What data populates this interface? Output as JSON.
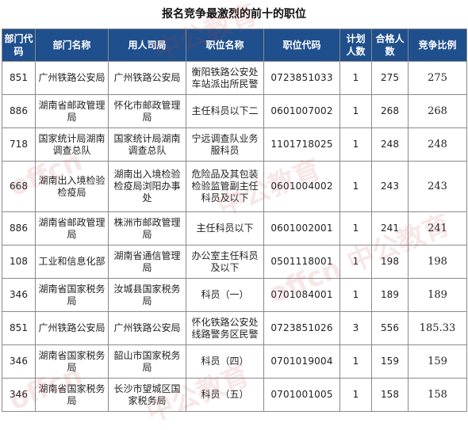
{
  "title": "报名竞争最激烈的前十的职位",
  "headers": [
    "部门代码",
    "部门名称",
    "用人司局",
    "职位名称",
    "职位代码",
    "计划人数",
    "合格人数",
    "竞争比例"
  ],
  "rows": [
    {
      "dept_code": "851",
      "dept_name": "广州铁路公安局",
      "bureau": "广州铁路公安局",
      "position": "衡阳铁路公安处车站派出所民警",
      "pos_code": "0723851033",
      "plan": "1",
      "qualified": "275",
      "ratio": "275"
    },
    {
      "dept_code": "886",
      "dept_name": "湖南省邮政管理局",
      "bureau": "怀化市邮政管理局",
      "position": "主任科员以下二",
      "pos_code": "0601007002",
      "plan": "1",
      "qualified": "268",
      "ratio": "268"
    },
    {
      "dept_code": "718",
      "dept_name": "国家统计局湖南调查总队",
      "bureau": "国家统计局湖南调查总队",
      "position": "宁远调查队业务服科员",
      "pos_code": "1101718025",
      "plan": "1",
      "qualified": "248",
      "ratio": "248"
    },
    {
      "dept_code": "668",
      "dept_name": "湖南出入境检验检疫局",
      "bureau": "湖南出入境检验检疫局浏阳办事处",
      "position": "危险品及其包装检验监管副主任科员及以下",
      "pos_code": "0601004002",
      "plan": "1",
      "qualified": "243",
      "ratio": "243"
    },
    {
      "dept_code": "886",
      "dept_name": "湖南省邮政管理局",
      "bureau": "株洲市邮政管理局",
      "position": "主任科员以下",
      "pos_code": "0601002001",
      "plan": "1",
      "qualified": "241",
      "ratio": "241"
    },
    {
      "dept_code": "108",
      "dept_name": "工业和信息化部",
      "bureau": "湖南省通信管理局",
      "position": "办公室主任科员及以下",
      "pos_code": "0501118001",
      "plan": "1",
      "qualified": "198",
      "ratio": "198"
    },
    {
      "dept_code": "346",
      "dept_name": "湖南省国家税务局",
      "bureau": "汝城县国家税务局",
      "position": "科员（一）",
      "pos_code": "0701084001",
      "plan": "1",
      "qualified": "189",
      "ratio": "189"
    },
    {
      "dept_code": "851",
      "dept_name": "广州铁路公安局",
      "bureau": "广州铁路公安局",
      "position": "怀化铁路公安处线路警务区民警",
      "pos_code": "0723851026",
      "plan": "3",
      "qualified": "556",
      "ratio": "185.33"
    },
    {
      "dept_code": "346",
      "dept_name": "湖南省国家税务局",
      "bureau": "韶山市国家税务局",
      "position": "科员（四）",
      "pos_code": "0701019004",
      "plan": "1",
      "qualified": "159",
      "ratio": "159"
    },
    {
      "dept_code": "346",
      "dept_name": "湖南省国家税务局",
      "bureau": "长沙市望城区国家税务局",
      "position": "科员（五）",
      "pos_code": "0701001005",
      "plan": "1",
      "qualified": "158",
      "ratio": "158"
    }
  ],
  "watermarks": [
    "中公教育",
    "offcn",
    "中公教育",
    "offcn 中公教育",
    "offcn",
    "中公教育"
  ]
}
